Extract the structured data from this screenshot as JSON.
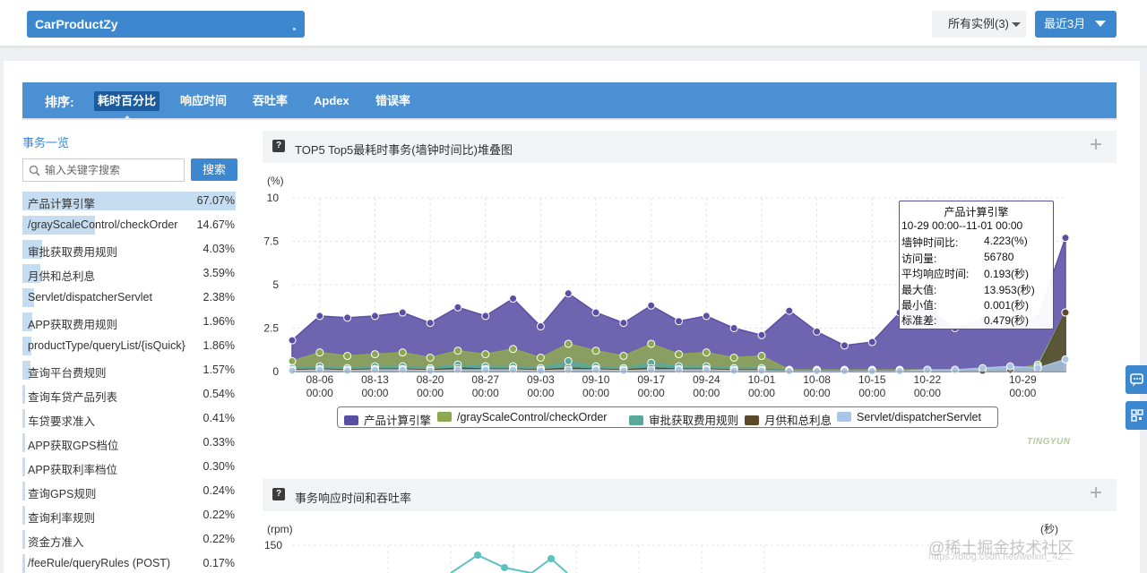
{
  "header": {
    "app_name": "CarProductZy",
    "instances_label": "所有实例(3)",
    "range_label": "最近3月"
  },
  "tabs": {
    "sort_label": "排序:",
    "items": [
      "耗时百分比",
      "响应时间",
      "吞吐率",
      "Apdex",
      "错误率"
    ],
    "active": "耗时百分比"
  },
  "sidebar": {
    "title": "事务一览",
    "search_placeholder": "输入关键字搜索",
    "search_button": "搜索",
    "transactions": [
      {
        "name": "产品计算引擎",
        "pct": "67.07%",
        "value": 67.07
      },
      {
        "name": "/grayScaleControl/checkOrder",
        "pct": "14.67%",
        "value": 14.67
      },
      {
        "name": "审批获取费用规则",
        "pct": "4.03%",
        "value": 4.03
      },
      {
        "name": "月供和总利息",
        "pct": "3.59%",
        "value": 3.59
      },
      {
        "name": "Servlet/dispatcherServlet",
        "pct": "2.38%",
        "value": 2.38
      },
      {
        "name": "APP获取费用规则",
        "pct": "1.96%",
        "value": 1.96
      },
      {
        "name": "productType/queryList/{isQuick}",
        "pct": "1.86%",
        "value": 1.86
      },
      {
        "name": "查询平台费规则",
        "pct": "1.57%",
        "value": 1.57
      },
      {
        "name": "查询车贷产品列表",
        "pct": "0.54%",
        "value": 0.54
      },
      {
        "name": "车贷要求准入",
        "pct": "0.41%",
        "value": 0.41
      },
      {
        "name": "APP获取GPS档位",
        "pct": "0.33%",
        "value": 0.33
      },
      {
        "name": "APP获取利率档位",
        "pct": "0.30%",
        "value": 0.3
      },
      {
        "name": "查询GPS规则",
        "pct": "0.24%",
        "value": 0.24
      },
      {
        "name": "查询利率规则",
        "pct": "0.22%",
        "value": 0.22
      },
      {
        "name": "资金方准入",
        "pct": "0.22%",
        "value": 0.22
      },
      {
        "name": "/feeRule/queryRules (POST)",
        "pct": "0.17%",
        "value": 0.17
      }
    ]
  },
  "chart1_card": {
    "title": "TOP5 Top5最耗时事务(墙钟时间比)堆叠图"
  },
  "chart_data": [
    {
      "type": "area",
      "ylabel": "(%)",
      "ylim": [
        0,
        10
      ],
      "yticks": [
        "0",
        "2.5",
        "5",
        "7.5",
        "10"
      ],
      "xtick_labels": [
        {
          "date": "08-06",
          "time": "00:00"
        },
        {
          "date": "08-13",
          "time": "00:00"
        },
        {
          "date": "08-20",
          "time": "00:00"
        },
        {
          "date": "08-27",
          "time": "00:00"
        },
        {
          "date": "09-03",
          "time": "00:00"
        },
        {
          "date": "09-10",
          "time": "00:00"
        },
        {
          "date": "09-17",
          "time": "00:00"
        },
        {
          "date": "09-24",
          "time": "00:00"
        },
        {
          "date": "10-01",
          "time": "00:00"
        },
        {
          "date": "10-08",
          "time": "00:00"
        },
        {
          "date": "10-15",
          "time": "00:00"
        },
        {
          "date": "10-22",
          "time": "00:00"
        },
        {
          "date": "10-29",
          "time": "00:00"
        }
      ],
      "stacked": true,
      "series": [
        {
          "name": "产品计算引擎",
          "color": "#5b4ea5",
          "totals": [
            1.8,
            3.2,
            3.1,
            3.2,
            3.4,
            2.8,
            3.7,
            3.2,
            4.2,
            2.6,
            4.5,
            3.4,
            2.8,
            3.8,
            2.9,
            3.2,
            2.5,
            2.1,
            3.5,
            2.3,
            1.5,
            1.7,
            3.4,
            3.6,
            2.5,
            3.0,
            2.9,
            3.1,
            7.7
          ]
        },
        {
          "name": "/grayScaleControl/checkOrder",
          "color": "#8ea852",
          "totals": [
            0.6,
            1.1,
            0.9,
            1.0,
            1.1,
            0.8,
            1.2,
            1.0,
            1.3,
            0.8,
            1.6,
            1.2,
            0.9,
            1.6,
            1.0,
            1.1,
            0.8,
            0.9,
            0.1,
            0.1,
            0.1,
            0.1,
            0.1,
            0.1,
            0.1,
            0.1,
            0.1,
            0.4,
            3.4
          ]
        },
        {
          "name": "审批获取费用规则",
          "color": "#5aa89a",
          "totals": [
            0.2,
            0.3,
            0.2,
            0.3,
            0.3,
            0.2,
            0.4,
            0.3,
            0.3,
            0.2,
            0.6,
            0.3,
            0.2,
            0.5,
            0.3,
            0.3,
            0.2,
            0.2,
            0.05,
            0.05,
            0.05,
            0.05,
            0.05,
            0.05,
            0.05,
            0.05,
            0.05,
            0.3,
            3.4
          ]
        },
        {
          "name": "月供和总利息",
          "color": "#5a4a2a",
          "totals": [
            0.1,
            0.15,
            0.1,
            0.15,
            0.15,
            0.1,
            0.2,
            0.15,
            0.15,
            0.1,
            0.2,
            0.15,
            0.1,
            0.2,
            0.15,
            0.15,
            0.1,
            0.1,
            0.05,
            0.05,
            0.05,
            0.05,
            0.05,
            0.05,
            0.05,
            0.05,
            0.1,
            0.2,
            3.4
          ]
        },
        {
          "name": "Servlet/dispatcherServlet",
          "color": "#a9c6e6",
          "totals": [
            0.05,
            0.1,
            0.05,
            0.1,
            0.1,
            0.05,
            0.1,
            0.1,
            0.1,
            0.05,
            0.1,
            0.1,
            0.05,
            0.1,
            0.1,
            0.1,
            0.05,
            0.05,
            0.03,
            0.03,
            0.03,
            0.03,
            0.03,
            0.1,
            0.1,
            0.2,
            0.3,
            0.2,
            0.7
          ]
        }
      ]
    },
    {
      "type": "line",
      "ylabel": "(rpm)",
      "y2label": "(秒)",
      "yticks": [
        "150"
      ]
    }
  ],
  "tooltip": {
    "title": "产品计算引擎",
    "range": "10-29 00:00--11-01 00:00",
    "rows": [
      {
        "k": "墙钟时间比:",
        "v": "4.223(%)"
      },
      {
        "k": "访问量:",
        "v": "56780"
      },
      {
        "k": "平均响应时间:",
        "v": "0.193(秒)"
      },
      {
        "k": "最大值:",
        "v": "13.953(秒)"
      },
      {
        "k": "最小值:",
        "v": "0.001(秒)"
      },
      {
        "k": "标准差:",
        "v": "0.479(秒)"
      }
    ]
  },
  "chart2_card": {
    "title": "事务响应时间和吞吐率"
  },
  "brand": "TINGYUN",
  "watermark": "@稀土掘金技术社区",
  "watermark_url": "https://blog.csdn.net/weixin_42...",
  "icons": {
    "search": "search-icon",
    "help": "help-icon",
    "expand": "plus-icon",
    "feedback": "chat-icon",
    "qr": "qrcode-icon"
  }
}
